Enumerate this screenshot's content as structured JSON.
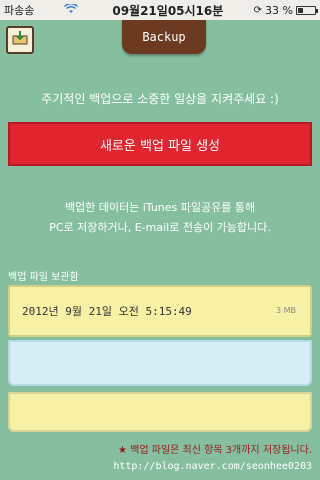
{
  "status_bar": {
    "carrier": "파송송",
    "time": "09월21일05시16분",
    "battery_percent": "33 %",
    "battery_level": 0.33
  },
  "header": {
    "title": "Backup",
    "back_icon": "tray-download-icon"
  },
  "hint_text": "주기적인 백업으로 소중한 일상을 지켜주세요 :)",
  "new_backup_label": "새로운 백업 파일 생성",
  "description": {
    "line1": "백업한 데이터는 iTunes 파일공유를 통해",
    "line2": "PC로 저장하거나, E-mail로 전송이 가능합니다."
  },
  "section_label": "백업 파일 보관함",
  "backup_slots": [
    {
      "date": "2012년 9월 21일 오전 5:15:49",
      "size": "3 MB"
    },
    {
      "date": "",
      "size": ""
    },
    {
      "date": "",
      "size": ""
    }
  ],
  "footer": {
    "note": "★ 백업 파일은 최신 항목 3개까지 저장됩니다.",
    "url": "http://blog.naver.com/seonhee0203"
  },
  "colors": {
    "background": "#86bfa0",
    "title_tab": "#6b3a20",
    "new_backup_button": "#e0252f",
    "slot_yellow": "#f7f1a6",
    "slot_blue": "#d6eef5",
    "note_red": "#9b1a1a"
  }
}
